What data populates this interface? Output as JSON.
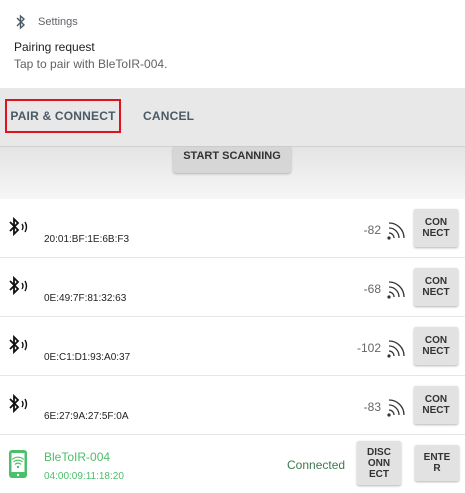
{
  "notification": {
    "app_icon": "bluetooth-icon",
    "app_name": "Settings",
    "title": "Pairing request",
    "body": "Tap to pair with BleToIR-004."
  },
  "actions": {
    "pair_label": "PAIR & CONNECT",
    "cancel_label": "CANCEL",
    "highlight_color": "#e0131c"
  },
  "scan": {
    "label": "START SCANNING"
  },
  "devices": [
    {
      "mac": "20:01:BF:1E:6B:F3",
      "rssi": "-82",
      "button": "CON\nNECT"
    },
    {
      "mac": "0E:49:7F:81:32:63",
      "rssi": "-68",
      "button": "CON\nNECT"
    },
    {
      "mac": "0E:C1:D1:93:A0:37",
      "rssi": "-102",
      "button": "CON\nNECT"
    },
    {
      "mac": "6E:27:9A:27:5F:0A",
      "rssi": "-83",
      "button": "CON\nNECT"
    }
  ],
  "connected_device": {
    "name": "BleToIR-004",
    "mac": "04:00:09:11:18:20",
    "status": "Connected",
    "disconnect_label": "DISC\nONN\nECT",
    "enter_label": "ENTE\nR",
    "accent_color": "#4cbf6a",
    "icon": "wireless-device-icon"
  }
}
